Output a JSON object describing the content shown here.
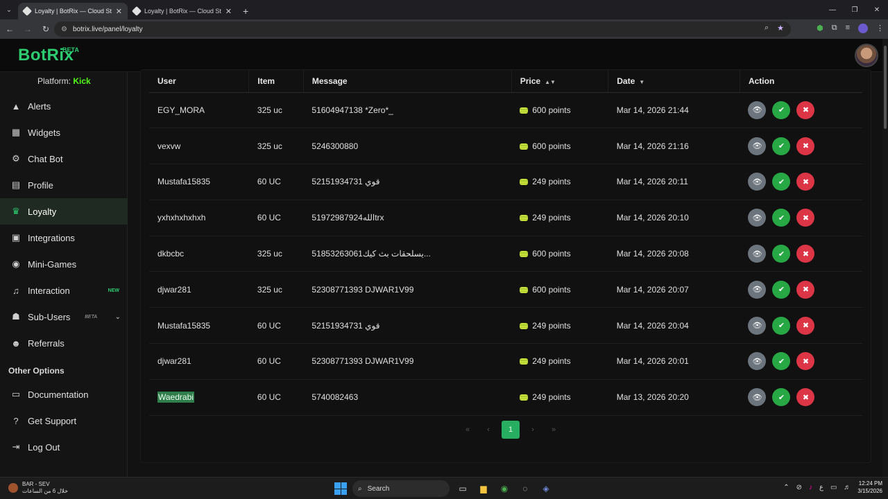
{
  "browser": {
    "tabs": [
      {
        "title": "Loyalty | BotRix — Cloud Stream",
        "active": true
      },
      {
        "title": "Loyalty | BotRix — Cloud Stream",
        "active": false
      }
    ],
    "url": "botrix.live/panel/loyalty"
  },
  "app": {
    "logo": "BotRix",
    "beta": "BETA",
    "platform_label": "Platform:",
    "platform_value": "Kick"
  },
  "sidebar": {
    "items": [
      {
        "label": "Alerts",
        "icon": "warning-icon"
      },
      {
        "label": "Widgets",
        "icon": "grid-icon"
      },
      {
        "label": "Chat Bot",
        "icon": "robot-icon"
      },
      {
        "label": "Profile",
        "icon": "id-card-icon"
      },
      {
        "label": "Loyalty",
        "icon": "trophy-icon",
        "active": true
      },
      {
        "label": "Integrations",
        "icon": "plug-icon"
      },
      {
        "label": "Mini-Games",
        "icon": "gamepad-icon"
      },
      {
        "label": "Interaction",
        "icon": "music-icon",
        "badge": "NEW"
      },
      {
        "label": "Sub-Users",
        "icon": "users-icon",
        "badge": "BETA"
      },
      {
        "label": "Referrals",
        "icon": "people-icon"
      }
    ],
    "other_heading": "Other Options",
    "other_items": [
      {
        "label": "Documentation",
        "icon": "document-icon"
      },
      {
        "label": "Get Support",
        "icon": "help-icon"
      },
      {
        "label": "Log Out",
        "icon": "logout-icon"
      }
    ]
  },
  "table": {
    "headers": [
      "User",
      "Item",
      "Message",
      "Price",
      "Date",
      "Action"
    ],
    "rows": [
      {
        "user": "EGY_MORA",
        "item": "325 uc",
        "message": "51604947138 *Zero*_",
        "price": "600 points",
        "date": "Mar 14, 2026 21:44"
      },
      {
        "user": "vexvw",
        "item": "325 uc",
        "message": "5246300880",
        "price": "600 points",
        "date": "Mar 14, 2026 21:16"
      },
      {
        "user": "Mustafa15835",
        "item": "60 UC",
        "message": "52151934731 قوي",
        "price": "249 points",
        "date": "Mar 14, 2026 20:11"
      },
      {
        "user": "yxhxhxhxhxh",
        "item": "60 UC",
        "message": "51972987924اللهtrx",
        "price": "249 points",
        "date": "Mar 14, 2026 20:10"
      },
      {
        "user": "dkbcbc",
        "item": "325 uc",
        "message": "51853263061يسلحقات بث كيك...",
        "price": "600 points",
        "date": "Mar 14, 2026 20:08"
      },
      {
        "user": "djwar281",
        "item": "325 uc",
        "message": "52308771393 DJWAR1V99",
        "price": "600 points",
        "date": "Mar 14, 2026 20:07"
      },
      {
        "user": "Mustafa15835",
        "item": "60 UC",
        "message": "52151934731 قوي",
        "price": "249 points",
        "date": "Mar 14, 2026 20:04"
      },
      {
        "user": "djwar281",
        "item": "60 UC",
        "message": "52308771393 DJWAR1V99",
        "price": "249 points",
        "date": "Mar 14, 2026 20:01"
      },
      {
        "user": "Waedrabi",
        "item": "60 UC",
        "message": "5740082463",
        "price": "249 points",
        "date": "Mar 13, 2026 20:20",
        "highlight": true
      }
    ]
  },
  "pagination": {
    "current": "1"
  },
  "taskbar": {
    "weather_title": "BAR - SEV",
    "weather_sub": "خلال 6 من الساعات",
    "search": "Search",
    "lang": "ع",
    "time": "12:24 PM",
    "date": "3/15/2026"
  }
}
